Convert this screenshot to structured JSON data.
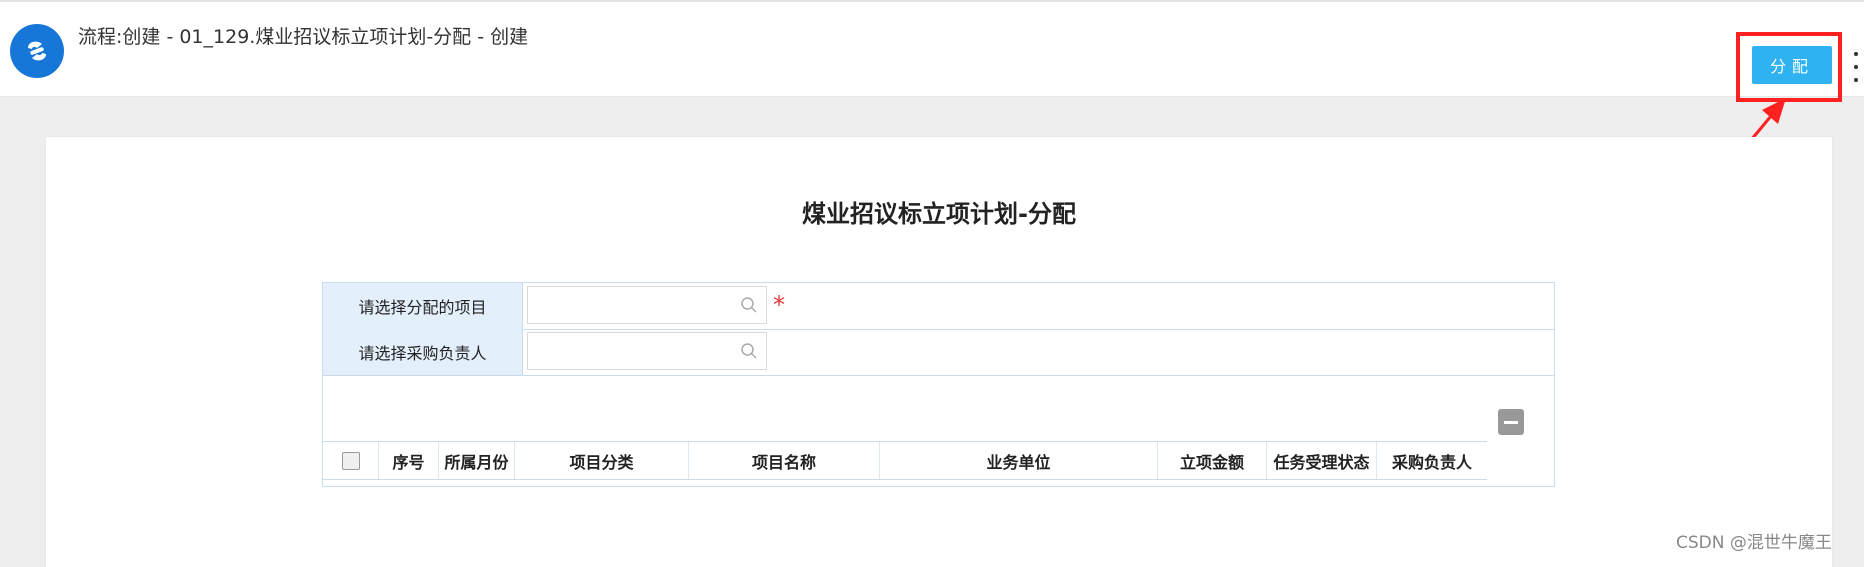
{
  "header": {
    "title": "流程:创建 - 01_129.煤业招议标立项计划-分配 - 创建",
    "assign_button": "分配",
    "logo_icon": "app-logo-icon",
    "more_icon": "more-vertical-icon"
  },
  "form": {
    "title": "煤业招议标立项计划-分配",
    "fields": [
      {
        "label": "请选择分配的项目",
        "value": "",
        "required_mark": "*"
      },
      {
        "label": "请选择采购负责人",
        "value": ""
      }
    ],
    "table": {
      "columns": [
        "序号",
        "所属月份",
        "项目分类",
        "项目名称",
        "业务单位",
        "立项金额",
        "任务受理状态",
        "采购负责人"
      ]
    }
  },
  "watermark": "CSDN @混世牛魔王",
  "colors": {
    "accent": "#2eb3f0",
    "highlight": "#ff2020",
    "label_bg": "#e3f0fb",
    "logo": "#1677d9"
  }
}
